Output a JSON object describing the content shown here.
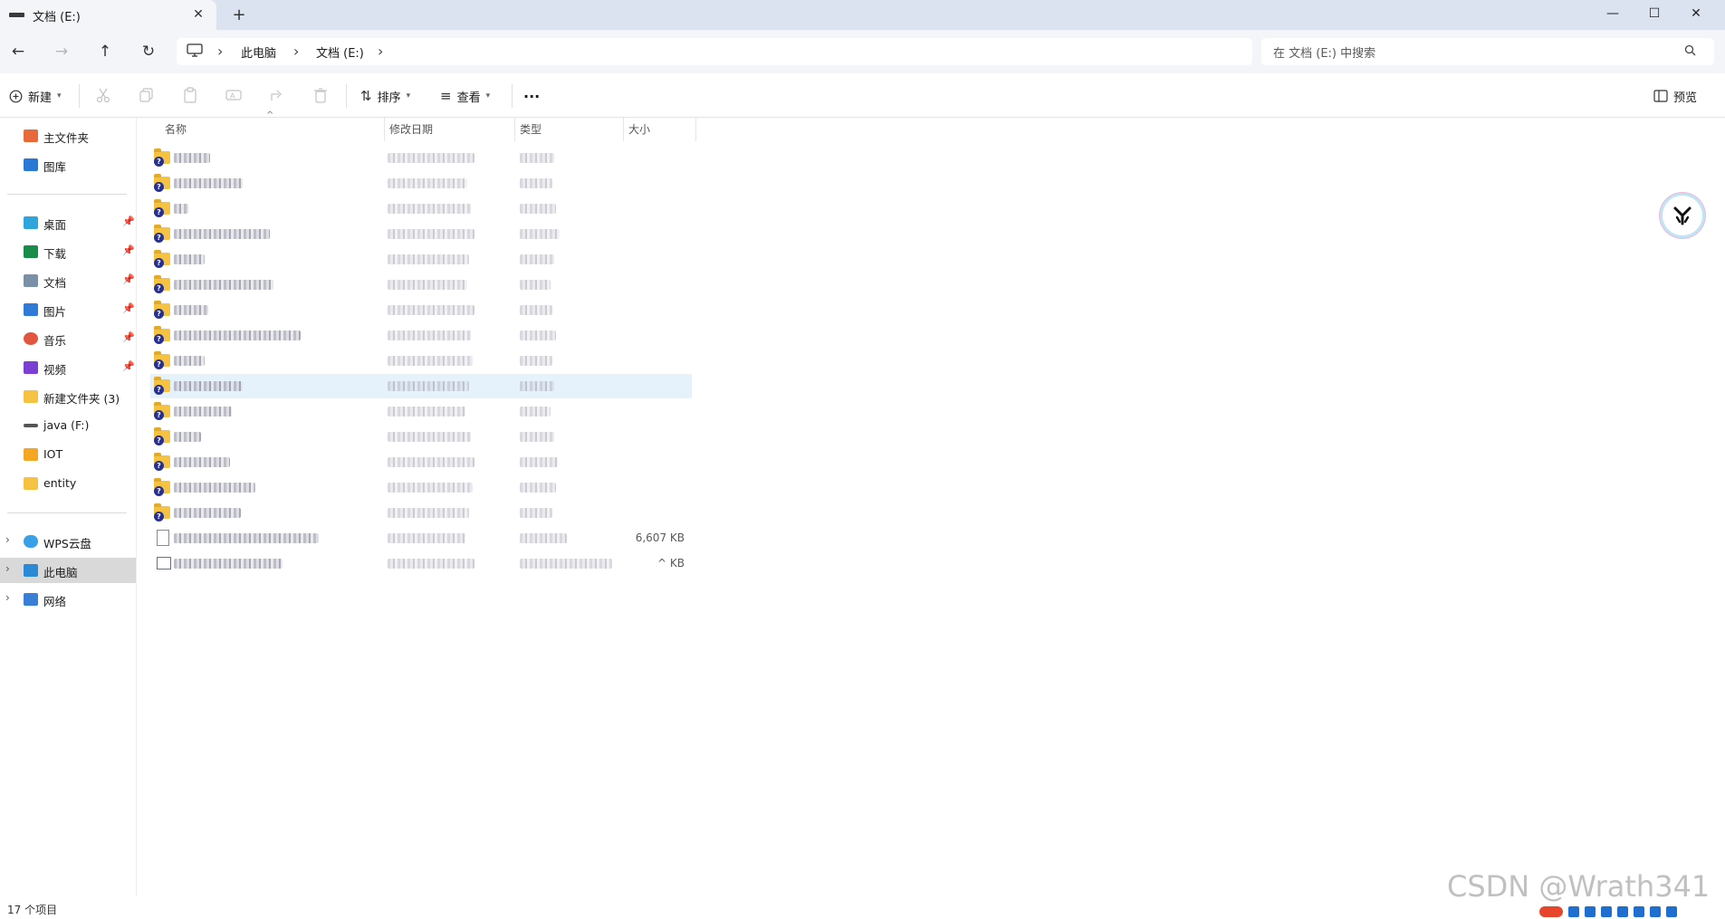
{
  "window": {
    "tab_title": "文档 (E:)",
    "tab_close_icon": "close-icon",
    "new_tab_label": "+",
    "controls": {
      "minimize": "—",
      "maximize": "☐",
      "close": "✕"
    }
  },
  "nav": {
    "back_icon": "back-arrow-icon",
    "forward_icon": "forward-arrow-icon",
    "up_icon": "up-arrow-icon",
    "refresh_icon": "refresh-icon"
  },
  "address": {
    "crumbs": [
      "此电脑",
      "文档 (E:)"
    ],
    "separator": "›"
  },
  "search": {
    "placeholder": "在 文档 (E:) 中搜索"
  },
  "toolbar": {
    "new_label": "新建",
    "sort_label": "排序",
    "view_label": "查看",
    "more_label": "···",
    "preview_label": "预览"
  },
  "sidebar": {
    "quick": [
      {
        "label": "主文件夹",
        "icon": "home-icon",
        "color": "#e86a3a"
      },
      {
        "label": "图库",
        "icon": "gallery-icon",
        "color": "#2a78d6"
      }
    ],
    "pinned": [
      {
        "label": "桌面",
        "icon": "desktop-icon",
        "color": "#2fa5dc"
      },
      {
        "label": "下载",
        "icon": "download-icon",
        "color": "#1a8c4a"
      },
      {
        "label": "文档",
        "icon": "documents-icon",
        "color": "#7a8fa8"
      },
      {
        "label": "图片",
        "icon": "pictures-icon",
        "color": "#2f7ad6"
      },
      {
        "label": "音乐",
        "icon": "music-icon",
        "color": "#e2553f"
      },
      {
        "label": "视频",
        "icon": "videos-icon",
        "color": "#7b3fd3"
      },
      {
        "label": "新建文件夹 (3)",
        "icon": "folder-icon",
        "color": "#f5c242"
      },
      {
        "label": "java (F:)",
        "icon": "drive-icon",
        "color": "#555555"
      },
      {
        "label": "IOT",
        "icon": "folder-sync-icon",
        "color": "#f5a623"
      },
      {
        "label": "entity",
        "icon": "folder-icon",
        "color": "#f5c242"
      }
    ],
    "tree": [
      {
        "label": "WPS云盘",
        "icon": "cloud-icon",
        "color": "#3aa0e8"
      },
      {
        "label": "此电脑",
        "icon": "this-pc-icon",
        "color": "#2a8ad6"
      },
      {
        "label": "网络",
        "icon": "network-icon",
        "color": "#3a7fd6"
      }
    ],
    "pin_glyph": "📌",
    "expand_glyph": "›"
  },
  "files": {
    "columns": [
      "名称",
      "修改日期",
      "类型",
      "大小"
    ],
    "rows": [
      {
        "kind": "folder",
        "size": ""
      },
      {
        "kind": "folder",
        "size": ""
      },
      {
        "kind": "folder",
        "size": ""
      },
      {
        "kind": "folder",
        "size": ""
      },
      {
        "kind": "folder",
        "size": ""
      },
      {
        "kind": "folder",
        "size": ""
      },
      {
        "kind": "folder",
        "size": ""
      },
      {
        "kind": "folder",
        "size": ""
      },
      {
        "kind": "folder",
        "size": ""
      },
      {
        "kind": "folder",
        "size": ""
      },
      {
        "kind": "folder",
        "size": ""
      },
      {
        "kind": "folder",
        "size": ""
      },
      {
        "kind": "folder",
        "size": ""
      },
      {
        "kind": "folder",
        "size": ""
      },
      {
        "kind": "folder",
        "size": ""
      },
      {
        "kind": "file",
        "size": "6,607 KB"
      },
      {
        "kind": "file",
        "size": "^ KB"
      }
    ]
  },
  "status": {
    "item_count": "17 个项目"
  },
  "watermark": "CSDN @Wrath341",
  "colors": {
    "accent": "#0067c0",
    "selection": "#e5f1fb",
    "titlebar": "#dce3f0"
  }
}
